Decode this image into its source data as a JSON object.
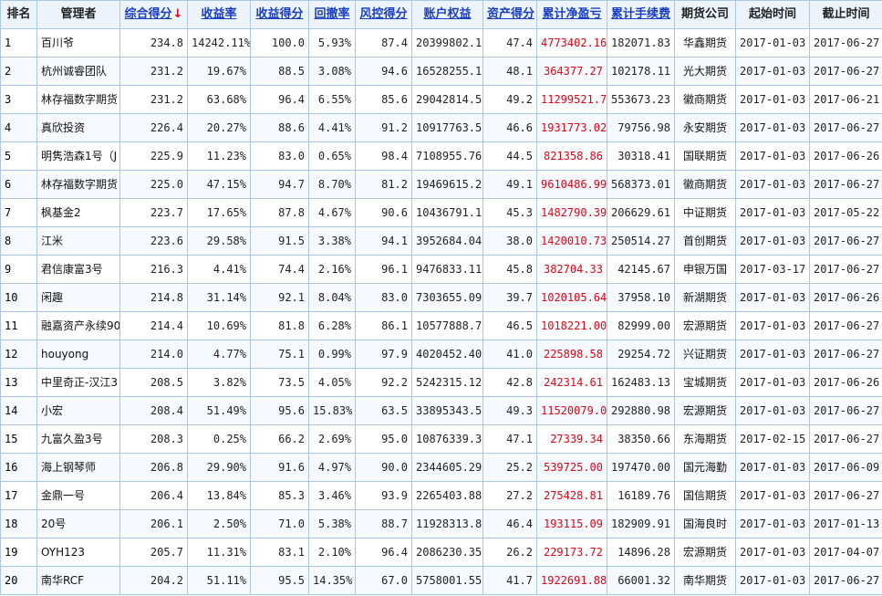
{
  "headers": {
    "rank": "排名",
    "manager": "管理者",
    "total_score": "综合得分",
    "sort_arrow": "↓",
    "return_rate": "收益率",
    "return_score": "收益得分",
    "drawdown": "回撤率",
    "risk_score": "风控得分",
    "equity": "账户权益",
    "asset_score": "资产得分",
    "net_pnl": "累计净盈亏",
    "fees": "累计手续费",
    "broker": "期货公司",
    "start": "起始时间",
    "end": "截止时间"
  },
  "rows": [
    {
      "rank": "1",
      "manager": "百川爷",
      "total_score": "234.8",
      "return_rate": "14242.11%",
      "return_score": "100.0",
      "drawdown": "5.93%",
      "risk_score": "87.4",
      "equity": "20399802.16",
      "asset_score": "47.4",
      "net_pnl": "4773402.16",
      "fees": "182071.83",
      "broker": "华鑫期货",
      "start": "2017-01-03",
      "end": "2017-06-27"
    },
    {
      "rank": "2",
      "manager": "杭州诚睿团队",
      "total_score": "231.2",
      "return_rate": "19.67%",
      "return_score": "88.5",
      "drawdown": "3.08%",
      "risk_score": "94.6",
      "equity": "16528255.17",
      "asset_score": "48.1",
      "net_pnl": "364377.27",
      "fees": "102178.11",
      "broker": "光大期货",
      "start": "2017-01-03",
      "end": "2017-06-27"
    },
    {
      "rank": "3",
      "manager": "林存福数字期货",
      "total_score": "231.2",
      "return_rate": "63.68%",
      "return_score": "96.4",
      "drawdown": "6.55%",
      "risk_score": "85.6",
      "equity": "29042814.52",
      "asset_score": "49.2",
      "net_pnl": "11299521.77",
      "fees": "553673.23",
      "broker": "徽商期货",
      "start": "2017-01-03",
      "end": "2017-06-21"
    },
    {
      "rank": "4",
      "manager": "真欣投资",
      "total_score": "226.4",
      "return_rate": "20.27%",
      "return_score": "88.6",
      "drawdown": "4.41%",
      "risk_score": "91.2",
      "equity": "10917763.57",
      "asset_score": "46.6",
      "net_pnl": "1931773.02",
      "fees": "79756.98",
      "broker": "永安期货",
      "start": "2017-01-03",
      "end": "2017-06-27"
    },
    {
      "rank": "5",
      "manager": "明隽浩森1号（J",
      "total_score": "225.9",
      "return_rate": "11.23%",
      "return_score": "83.0",
      "drawdown": "0.65%",
      "risk_score": "98.4",
      "equity": "7108955.76",
      "asset_score": "44.5",
      "net_pnl": "821358.86",
      "fees": "30318.41",
      "broker": "国联期货",
      "start": "2017-01-03",
      "end": "2017-06-26"
    },
    {
      "rank": "6",
      "manager": "林存福数字期货",
      "total_score": "225.0",
      "return_rate": "47.15%",
      "return_score": "94.7",
      "drawdown": "8.70%",
      "risk_score": "81.2",
      "equity": "19469615.24",
      "asset_score": "49.1",
      "net_pnl": "9610486.99",
      "fees": "568373.01",
      "broker": "徽商期货",
      "start": "2017-01-03",
      "end": "2017-06-27"
    },
    {
      "rank": "7",
      "manager": "枫基金2",
      "total_score": "223.7",
      "return_rate": "17.65%",
      "return_score": "87.8",
      "drawdown": "4.67%",
      "risk_score": "90.6",
      "equity": "10436791.15",
      "asset_score": "45.3",
      "net_pnl": "1482790.39",
      "fees": "206629.61",
      "broker": "中证期货",
      "start": "2017-01-03",
      "end": "2017-05-22"
    },
    {
      "rank": "8",
      "manager": "江米",
      "total_score": "223.6",
      "return_rate": "29.58%",
      "return_score": "91.5",
      "drawdown": "3.38%",
      "risk_score": "94.1",
      "equity": "3952684.04",
      "asset_score": "38.0",
      "net_pnl": "1420010.73",
      "fees": "250514.27",
      "broker": "首创期货",
      "start": "2017-01-03",
      "end": "2017-06-27"
    },
    {
      "rank": "9",
      "manager": "君信康富3号",
      "total_score": "216.3",
      "return_rate": "4.41%",
      "return_score": "74.4",
      "drawdown": "2.16%",
      "risk_score": "96.1",
      "equity": "9476833.11",
      "asset_score": "45.8",
      "net_pnl": "382704.33",
      "fees": "42145.67",
      "broker": "申银万国",
      "start": "2017-03-17",
      "end": "2017-06-27"
    },
    {
      "rank": "10",
      "manager": "闲趣",
      "total_score": "214.8",
      "return_rate": "31.14%",
      "return_score": "92.1",
      "drawdown": "8.04%",
      "risk_score": "83.0",
      "equity": "7303655.09",
      "asset_score": "39.7",
      "net_pnl": "1020105.64",
      "fees": "37958.10",
      "broker": "新湖期货",
      "start": "2017-01-03",
      "end": "2017-06-26"
    },
    {
      "rank": "11",
      "manager": "融嘉资产永续90",
      "total_score": "214.4",
      "return_rate": "10.69%",
      "return_score": "81.8",
      "drawdown": "6.28%",
      "risk_score": "86.1",
      "equity": "10577888.72",
      "asset_score": "46.5",
      "net_pnl": "1018221.00",
      "fees": "82999.00",
      "broker": "宏源期货",
      "start": "2017-01-03",
      "end": "2017-06-27"
    },
    {
      "rank": "12",
      "manager": "houyong",
      "total_score": "214.0",
      "return_rate": "4.77%",
      "return_score": "75.1",
      "drawdown": "0.99%",
      "risk_score": "97.9",
      "equity": "4020452.40",
      "asset_score": "41.0",
      "net_pnl": "225898.58",
      "fees": "29254.72",
      "broker": "兴证期货",
      "start": "2017-01-03",
      "end": "2017-06-27"
    },
    {
      "rank": "13",
      "manager": "中里奇正-汉江3",
      "total_score": "208.5",
      "return_rate": "3.82%",
      "return_score": "73.5",
      "drawdown": "4.05%",
      "risk_score": "92.2",
      "equity": "5242315.12",
      "asset_score": "42.8",
      "net_pnl": "242314.61",
      "fees": "162483.13",
      "broker": "宝城期货",
      "start": "2017-01-03",
      "end": "2017-06-26"
    },
    {
      "rank": "14",
      "manager": "小宏",
      "total_score": "208.4",
      "return_rate": "51.49%",
      "return_score": "95.6",
      "drawdown": "15.83%",
      "risk_score": "63.5",
      "equity": "33895343.56",
      "asset_score": "49.3",
      "net_pnl": "11520079.02",
      "fees": "292880.98",
      "broker": "宏源期货",
      "start": "2017-01-03",
      "end": "2017-06-27"
    },
    {
      "rank": "15",
      "manager": "九富久盈3号",
      "total_score": "208.3",
      "return_rate": "0.25%",
      "return_score": "66.2",
      "drawdown": "2.69%",
      "risk_score": "95.0",
      "equity": "10876339.34",
      "asset_score": "47.1",
      "net_pnl": "27339.34",
      "fees": "38350.66",
      "broker": "东海期货",
      "start": "2017-02-15",
      "end": "2017-06-27"
    },
    {
      "rank": "16",
      "manager": "海上钢琴师",
      "total_score": "206.8",
      "return_rate": "29.90%",
      "return_score": "91.6",
      "drawdown": "4.97%",
      "risk_score": "90.0",
      "equity": "2344605.29",
      "asset_score": "25.2",
      "net_pnl": "539725.00",
      "fees": "197470.00",
      "broker": "国元海勤",
      "start": "2017-01-03",
      "end": "2017-06-09"
    },
    {
      "rank": "17",
      "manager": "金鼎一号",
      "total_score": "206.4",
      "return_rate": "13.84%",
      "return_score": "85.3",
      "drawdown": "3.46%",
      "risk_score": "93.9",
      "equity": "2265403.88",
      "asset_score": "27.2",
      "net_pnl": "275428.81",
      "fees": "16189.76",
      "broker": "国信期货",
      "start": "2017-01-03",
      "end": "2017-06-27"
    },
    {
      "rank": "18",
      "manager": "20号",
      "total_score": "206.1",
      "return_rate": "2.50%",
      "return_score": "71.0",
      "drawdown": "5.38%",
      "risk_score": "88.7",
      "equity": "11928313.87",
      "asset_score": "46.4",
      "net_pnl": "193115.09",
      "fees": "182909.91",
      "broker": "国海良时",
      "start": "2017-01-03",
      "end": "2017-01-13"
    },
    {
      "rank": "19",
      "manager": "OYH123",
      "total_score": "205.7",
      "return_rate": "11.31%",
      "return_score": "83.1",
      "drawdown": "2.10%",
      "risk_score": "96.4",
      "equity": "2086230.35",
      "asset_score": "26.2",
      "net_pnl": "229173.72",
      "fees": "14896.28",
      "broker": "宏源期货",
      "start": "2017-01-03",
      "end": "2017-04-07"
    },
    {
      "rank": "20",
      "manager": "南华RCF",
      "total_score": "204.2",
      "return_rate": "51.11%",
      "return_score": "95.5",
      "drawdown": "14.35%",
      "risk_score": "67.0",
      "equity": "5758001.55",
      "asset_score": "41.7",
      "net_pnl": "1922691.88",
      "fees": "66001.32",
      "broker": "南华期货",
      "start": "2017-01-03",
      "end": "2017-06-27"
    }
  ],
  "colors": {
    "header_bg": "#ecf3fb",
    "border": "#a9c6e6",
    "link": "#1a3fc4",
    "pnl_red": "#e60012"
  }
}
